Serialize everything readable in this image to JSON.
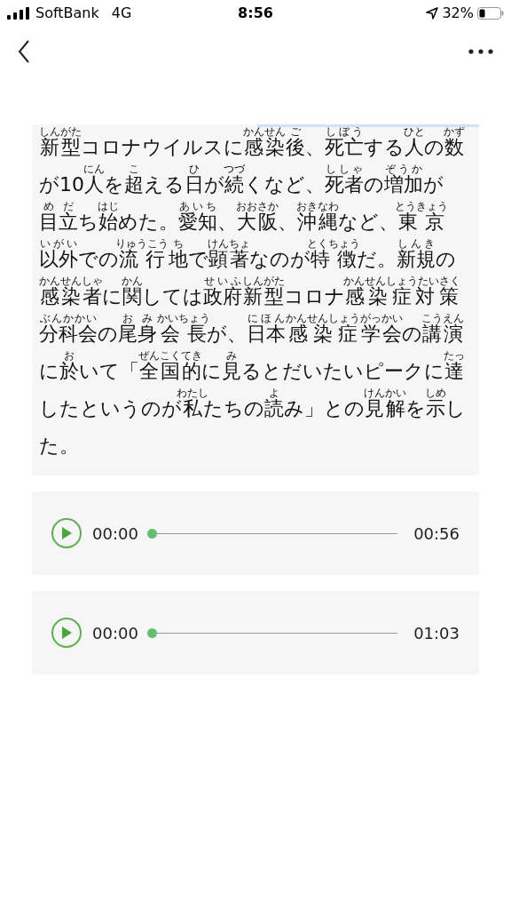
{
  "status_bar": {
    "carrier": "SoftBank",
    "network": "4G",
    "time": "8:56",
    "battery": "32%"
  },
  "article": {
    "lines": [
      [
        {
          "text": "新型",
          "ruby": "しんがた"
        },
        {
          "text": "コロナウイルスに"
        },
        {
          "text": "感染",
          "ruby": "かんせん"
        },
        {
          "text": "後",
          "ruby": "ご"
        },
        {
          "text": "、"
        },
        {
          "text": "死亡",
          "ruby": "しぼう"
        },
        {
          "text": "する"
        },
        {
          "text": "人",
          "ruby": "ひと"
        },
        {
          "text": "の"
        },
        {
          "text": "数",
          "ruby": "かず"
        }
      ],
      [
        {
          "text": "が10"
        },
        {
          "text": "人",
          "ruby": "にん"
        },
        {
          "text": "を"
        },
        {
          "text": "超",
          "ruby": "こ"
        },
        {
          "text": "える"
        },
        {
          "text": "日",
          "ruby": "ひ"
        },
        {
          "text": "が"
        },
        {
          "text": "続",
          "ruby": "つづ"
        },
        {
          "text": "くなど、"
        },
        {
          "text": "死者",
          "ruby": "ししゃ"
        },
        {
          "text": "の"
        },
        {
          "text": "増加",
          "ruby": "ぞうか"
        },
        {
          "text": "が"
        }
      ],
      [
        {
          "text": "目立",
          "ruby": "めだ"
        },
        {
          "text": "ち"
        },
        {
          "text": "始",
          "ruby": "はじ"
        },
        {
          "text": "めた。"
        },
        {
          "text": "愛知",
          "ruby": "あいち"
        },
        {
          "text": "、"
        },
        {
          "text": "大阪",
          "ruby": "おおさか"
        },
        {
          "text": "、"
        },
        {
          "text": "沖縄",
          "ruby": "おきなわ"
        },
        {
          "text": "など、"
        },
        {
          "text": "東京",
          "ruby": "とうきょう"
        }
      ],
      [
        {
          "text": "以外",
          "ruby": "いがい"
        },
        {
          "text": "での"
        },
        {
          "text": "流行",
          "ruby": "りゅうこう"
        },
        {
          "text": "地",
          "ruby": "ち"
        },
        {
          "text": "で"
        },
        {
          "text": "顕著",
          "ruby": "けんちょ"
        },
        {
          "text": "なのが"
        },
        {
          "text": "特徴",
          "ruby": "とくちょう"
        },
        {
          "text": "だ。"
        },
        {
          "text": "新規",
          "ruby": "しんき"
        },
        {
          "text": "の"
        }
      ],
      [
        {
          "text": "感染者",
          "ruby": "かんせんしゃ"
        },
        {
          "text": "に"
        },
        {
          "text": "関",
          "ruby": "かん"
        },
        {
          "text": "しては"
        },
        {
          "text": "政府",
          "ruby": "せいふ"
        },
        {
          "text": "新型",
          "ruby": "しんがた"
        },
        {
          "text": "コロナ"
        },
        {
          "text": "感染症対策",
          "ruby": "かんせんしょうたいさく"
        }
      ],
      [
        {
          "text": "分科会",
          "ruby": "ぶんかかい"
        },
        {
          "text": "の"
        },
        {
          "text": "尾身",
          "ruby": "おみ"
        },
        {
          "text": "会長",
          "ruby": "かいちょう"
        },
        {
          "text": "が、"
        },
        {
          "text": "日本",
          "ruby": "にほん"
        },
        {
          "text": "感染症",
          "ruby": "かんせんしょう"
        },
        {
          "text": "学会",
          "ruby": "がっかい"
        },
        {
          "text": "の"
        },
        {
          "text": "講演",
          "ruby": "こうえん"
        }
      ],
      [
        {
          "text": "に"
        },
        {
          "text": "於",
          "ruby": "お"
        },
        {
          "text": "いて「"
        },
        {
          "text": "全国的",
          "ruby": "ぜんこくてき"
        },
        {
          "text": "に"
        },
        {
          "text": "見",
          "ruby": "み"
        },
        {
          "text": "るとだいたいピークに"
        },
        {
          "text": "達",
          "ruby": "たっ"
        }
      ],
      [
        {
          "text": "したというのが"
        },
        {
          "text": "私",
          "ruby": "わたし"
        },
        {
          "text": "たちの"
        },
        {
          "text": "読",
          "ruby": "よ"
        },
        {
          "text": "み」との"
        },
        {
          "text": "見解",
          "ruby": "けんかい"
        },
        {
          "text": "を"
        },
        {
          "text": "示",
          "ruby": "しめ"
        },
        {
          "text": "し"
        }
      ],
      [
        {
          "text": "た。"
        }
      ]
    ]
  },
  "audio_players": [
    {
      "current": "00:00",
      "duration": "00:56",
      "level": 0
    },
    {
      "current": "00:00",
      "duration": "01:03",
      "level": 0
    }
  ]
}
